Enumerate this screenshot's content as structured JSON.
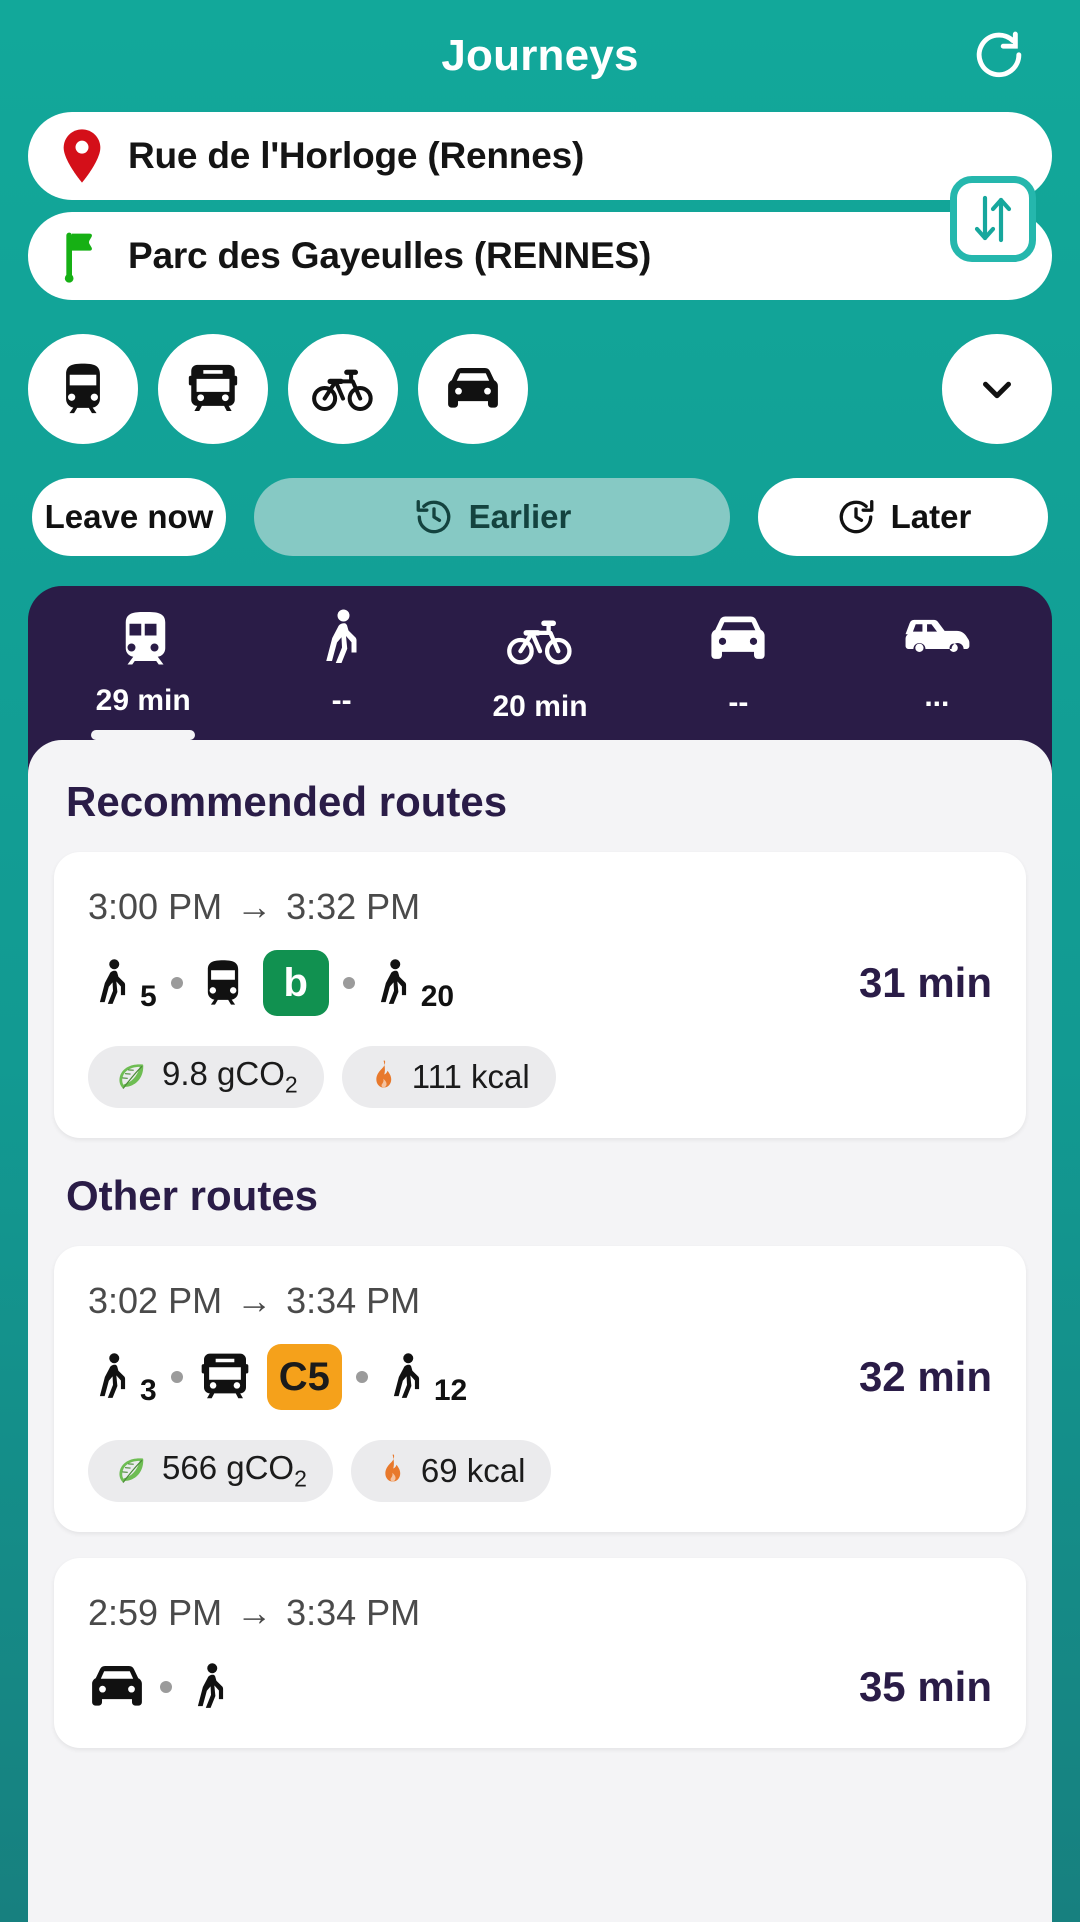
{
  "header": {
    "title": "Journeys",
    "refresh_icon": "refresh-icon"
  },
  "search": {
    "origin": {
      "icon": "map-pin-icon",
      "value": "Rue de l'Horloge (Rennes)"
    },
    "destination": {
      "icon": "flag-icon",
      "value": "Parc des Gayeulles (RENNES)"
    },
    "swap_icon": "swap-vertical-icon"
  },
  "modes": [
    {
      "icon": "metro-icon",
      "name": "mode-metro"
    },
    {
      "icon": "bus-icon",
      "name": "mode-bus"
    },
    {
      "icon": "bike-icon",
      "name": "mode-bike"
    },
    {
      "icon": "car-icon",
      "name": "mode-car"
    }
  ],
  "modes_expand": {
    "icon": "chevron-down-icon"
  },
  "time_options": {
    "leave_now": "Leave now",
    "earlier": "Earlier",
    "earlier_icon": "clock-back-icon",
    "later": "Later",
    "later_icon": "clock-forward-icon"
  },
  "tabs": [
    {
      "icon": "train-icon",
      "duration": "29 min",
      "selected": true
    },
    {
      "icon": "walk-icon",
      "duration": "--",
      "selected": false
    },
    {
      "icon": "bike-icon",
      "duration": "20 min",
      "selected": false
    },
    {
      "icon": "car-icon",
      "duration": "--",
      "selected": false
    },
    {
      "icon": "carpool-icon",
      "duration": "...",
      "selected": false
    }
  ],
  "sections": {
    "recommended_title": "Recommended routes",
    "other_title": "Other routes"
  },
  "routes": {
    "recommended": [
      {
        "depart": "3:00 PM",
        "arrive": "3:32 PM",
        "arrow": "→",
        "duration": "31 min",
        "legs": [
          {
            "type": "walk",
            "value": "5"
          },
          {
            "type": "metro",
            "line": "b",
            "color": "#119150",
            "text_color": "#ffffff"
          },
          {
            "type": "walk",
            "value": "20"
          }
        ],
        "co2": "9.8 gCO",
        "co2_sub": "2",
        "kcal": "111 kcal"
      }
    ],
    "other": [
      {
        "depart": "3:02 PM",
        "arrive": "3:34 PM",
        "arrow": "→",
        "duration": "32 min",
        "legs": [
          {
            "type": "walk",
            "value": "3"
          },
          {
            "type": "bus",
            "line": "C5",
            "color": "#f5a11b",
            "text_color": "#1b1b1b"
          },
          {
            "type": "walk",
            "value": "12"
          }
        ],
        "co2": "566 gCO",
        "co2_sub": "2",
        "kcal": "69 kcal"
      },
      {
        "depart": "2:59 PM",
        "arrive": "3:34 PM",
        "arrow": "→",
        "duration": "35 min",
        "legs": [
          {
            "type": "car",
            "value": ""
          },
          {
            "type": "walk",
            "value": ""
          }
        ]
      }
    ]
  },
  "colors": {
    "brand_teal": "#12a89a",
    "panel_dark": "#2a1c47",
    "sheet_bg": "#f4f4f6",
    "metro_b": "#119150",
    "bus_c5": "#f5a11b",
    "pin_red": "#d40f19",
    "flag_green": "#16b014",
    "leaf_green": "#6ebd53",
    "flame_orange": "#e8792c",
    "earlier_chip": "#86c9c4"
  }
}
